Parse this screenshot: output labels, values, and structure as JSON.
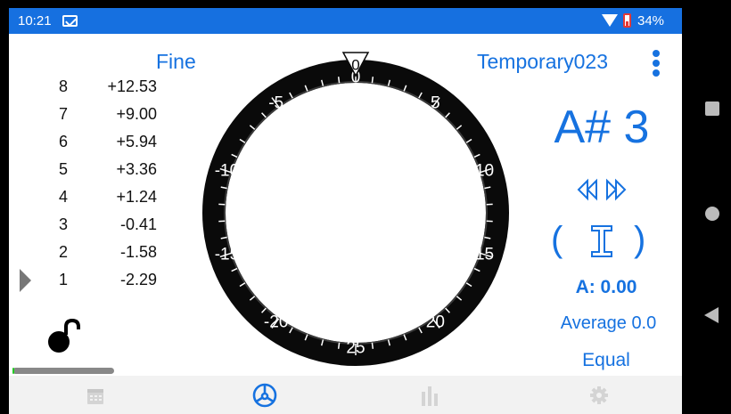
{
  "status_bar": {
    "time": "10:21",
    "battery": "34%",
    "icons": [
      "mail-icon",
      "wifi-icon",
      "battery-low-icon"
    ]
  },
  "header": {
    "mode": "Fine",
    "temperament_preset": "Temporary023"
  },
  "partials": [
    {
      "number": "8",
      "cents": "+12.53"
    },
    {
      "number": "7",
      "cents": "+9.00"
    },
    {
      "number": "6",
      "cents": "+5.94"
    },
    {
      "number": "5",
      "cents": "+3.36"
    },
    {
      "number": "4",
      "cents": "+1.24"
    },
    {
      "number": "3",
      "cents": "-0.41"
    },
    {
      "number": "2",
      "cents": "-1.58"
    },
    {
      "number": "1",
      "cents": "-2.29"
    }
  ],
  "selected_partial": "1",
  "dial": {
    "labels": [
      {
        "text": "0",
        "value": 0
      },
      {
        "text": "5",
        "value": 5
      },
      {
        "text": "10",
        "value": 10
      },
      {
        "text": "15",
        "value": 15
      },
      {
        "text": "20",
        "value": 20
      },
      {
        "text": "25",
        "value": 25
      },
      {
        "text": "-20",
        "value": -20
      },
      {
        "text": "-15",
        "value": -15
      },
      {
        "text": "-10",
        "value": -10
      },
      {
        "text": "-5",
        "value": -5
      }
    ],
    "range": 50
  },
  "note": {
    "name": "A# 3"
  },
  "reference": {
    "a_offset": "A: 0.00",
    "average": "Average 0.0",
    "temperament": "Equal"
  },
  "progress": {
    "fraction": 0.02
  },
  "colors": {
    "accent": "#1672e0",
    "status_bar": "#1670e0",
    "nav_inactive": "#cfcfcf"
  },
  "bottom_nav": [
    "calendar-icon",
    "steering-wheel-icon",
    "bar-chart-icon",
    "gear-icon"
  ]
}
